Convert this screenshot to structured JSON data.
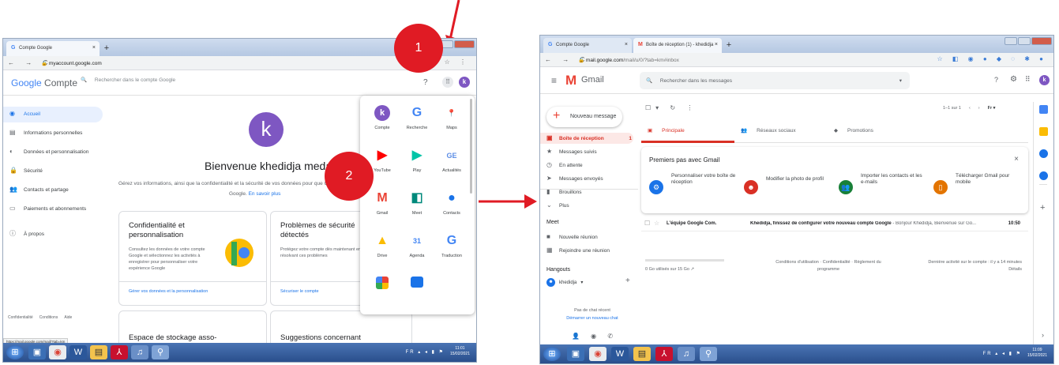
{
  "left": {
    "tab_title": "Compte Google",
    "url_host": "myaccount.google.com",
    "app_name_g": "Google",
    "app_name": "Compte",
    "search_placeholder": "Rechercher dans le compte Google",
    "avatar_letter": "k",
    "sidebar": [
      {
        "icon": "home-icon",
        "glyph": "◉",
        "label": "Accueil"
      },
      {
        "icon": "id-card-icon",
        "glyph": "▤",
        "label": "Informations personnelles"
      },
      {
        "icon": "toggle-icon",
        "glyph": "◐",
        "label": "Données et personnalisation"
      },
      {
        "icon": "lock-icon",
        "glyph": "🔒",
        "label": "Sécurité"
      },
      {
        "icon": "people-icon",
        "glyph": "👥",
        "label": "Contacts et partage"
      },
      {
        "icon": "card-icon",
        "glyph": "▭",
        "label": "Paiements et abonnements"
      },
      {
        "icon": "info-icon",
        "glyph": "ⓘ",
        "label": "À propos"
      }
    ],
    "welcome": "Bienvenue khedidja medani",
    "intro": "Gérez vos informations, ainsi que la confidentialité et la sécurité de vos données pour que Google",
    "intro2": "Google.",
    "learn_more": "En savoir plus",
    "card1": {
      "title": "Confidentialité et personnalisation",
      "text": "Consultez les données de votre compte Google et sélectionnez les activités à enregistrer pour personnaliser votre expérience Google",
      "link": "Gérer vos données et la personnalisation"
    },
    "card2": {
      "title": "Problèmes de sécurité détectés",
      "text": "Protégez votre compte dès maintenant en résolvant ces problèmes",
      "link": "Sécuriser le compte"
    },
    "card3": {
      "title": "Espace de stockage asso-"
    },
    "card4": {
      "title": "Suggestions concernant"
    },
    "footer": {
      "privacy": "Confidentialité",
      "terms": "Conditions",
      "help": "Aide"
    },
    "status_url": "https://mail.google.com/mail/?tab=km",
    "apps": [
      {
        "name": "Compte",
        "icon": "account-icon",
        "glyph": "k",
        "color": "#7e57c2",
        "round": true
      },
      {
        "name": "Recherche",
        "icon": "google-search-icon",
        "glyph": "G",
        "color": "#4285f4"
      },
      {
        "name": "Maps",
        "icon": "maps-icon",
        "glyph": "📍",
        "color": "#34a853"
      },
      {
        "name": "YouTube",
        "icon": "youtube-icon",
        "glyph": "▶",
        "color": "#ff0000"
      },
      {
        "name": "Play",
        "icon": "play-icon",
        "glyph": "▶",
        "color": "#00c4a7"
      },
      {
        "name": "Actualités",
        "icon": "news-icon",
        "glyph": "GE",
        "color": "#5c8de6"
      },
      {
        "name": "Gmail",
        "icon": "gmail-icon",
        "glyph": "M",
        "color": "#ea4335"
      },
      {
        "name": "Meet",
        "icon": "meet-icon",
        "glyph": "◧",
        "color": "#00897b"
      },
      {
        "name": "Contacts",
        "icon": "contacts-icon",
        "glyph": "●",
        "color": "#1a73e8"
      },
      {
        "name": "Drive",
        "icon": "drive-icon",
        "glyph": "▲",
        "color": "#fbbc04"
      },
      {
        "name": "Agenda",
        "icon": "calendar-icon",
        "glyph": "31",
        "color": "#4285f4"
      },
      {
        "name": "Traduction",
        "icon": "translate-icon",
        "glyph": "G",
        "color": "#4285f4"
      }
    ],
    "lang": "FR",
    "time": "11:01",
    "date": "15/02/2021"
  },
  "annotations": {
    "step1": "1",
    "step2": "2"
  },
  "right": {
    "tab1_title": "Compte Google",
    "tab2_title": "Boîte de réception (1) - khedidja",
    "url_host": "mail.google.com",
    "url_path": "/mail/u/0/?tab=km#inbox",
    "app_name": "Gmail",
    "search_placeholder": "Rechercher dans les messages",
    "compose": "Nouveau message",
    "nav": [
      {
        "icon": "inbox-icon",
        "glyph": "▣",
        "label": "Boîte de réception",
        "count": "1",
        "active": true
      },
      {
        "icon": "star-icon",
        "glyph": "★",
        "label": "Messages suivis",
        "count": ""
      },
      {
        "icon": "clock-icon",
        "glyph": "◷",
        "label": "En attente",
        "count": ""
      },
      {
        "icon": "send-icon",
        "glyph": "➤",
        "label": "Messages envoyés",
        "count": ""
      },
      {
        "icon": "draft-icon",
        "glyph": "▮",
        "label": "Brouillons",
        "count": ""
      },
      {
        "icon": "chevron-down-icon",
        "glyph": "⌄",
        "label": "Plus",
        "count": ""
      }
    ],
    "meet_title": "Meet",
    "meet_items": [
      {
        "icon": "video-icon",
        "glyph": "■",
        "label": "Nouvelle réunion"
      },
      {
        "icon": "keyboard-icon",
        "glyph": "▦",
        "label": "Rejoindre une réunion"
      }
    ],
    "hangouts_title": "Hangouts",
    "hangouts_user": "khedidja",
    "no_chat": "Pas de chat récent",
    "start_chat": "Démarrer un nouveau chat",
    "pagination": "1–1 sur 1",
    "lang_code": "Fr",
    "tabs": [
      {
        "icon": "inbox-icon",
        "glyph": "▣",
        "label": "Principale",
        "active": true
      },
      {
        "icon": "people-icon",
        "glyph": "👥",
        "label": "Réseaux sociaux",
        "active": false
      },
      {
        "icon": "tag-icon",
        "glyph": "◆",
        "label": "Promotions",
        "active": false
      }
    ],
    "onboarding_title": "Premiers pas avec Gmail",
    "tiles": [
      {
        "icon": "gear-icon",
        "glyph": "⚙",
        "color": "#1a73e8",
        "label": "Personnaliser votre boîte de réception"
      },
      {
        "icon": "avatar-icon",
        "glyph": "☻",
        "color": "#d93025",
        "label": "Modifier la photo de profil"
      },
      {
        "icon": "contacts-import-icon",
        "glyph": "👥",
        "color": "#188038",
        "label": "Importer les contacts et les e-mails"
      },
      {
        "icon": "phone-icon",
        "glyph": "▯",
        "color": "#e37400",
        "label": "Télécharger Gmail pour mobile"
      }
    ],
    "email": {
      "sender": "L'équipe Google Com.",
      "subject": "Khedidja, finissez de configurer votre nouveau compte Google",
      "snippet": " - Bonjour Khedidja, Bienvenue sur Go...",
      "time": "10:50"
    },
    "storage": "0 Go utilisés sur 15 Go",
    "footer_terms": "Conditions d'utilisation · Confidentialité · Règlement du programme",
    "last_activity": "Dernière activité sur le compte : il y a 14 minutes",
    "details": "Détails",
    "lang": "FR",
    "time": "11:09",
    "date": "15/02/2021"
  },
  "colors": {
    "google_blue": "#1a73e8",
    "gmail_red": "#d93025",
    "annotation_red": "#e01b24",
    "avatar_purple": "#7e57c2"
  }
}
